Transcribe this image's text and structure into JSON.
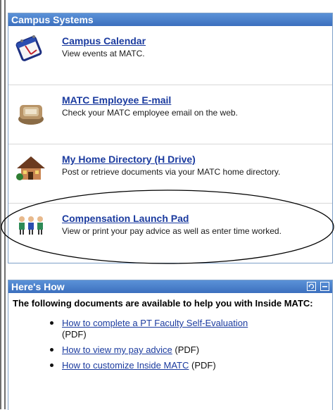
{
  "campus_systems": {
    "title": "Campus Systems",
    "items": [
      {
        "icon": "calendar-icon",
        "label": "Campus Calendar",
        "description": "View events at MATC."
      },
      {
        "icon": "email-icon",
        "label": "MATC Employee E-mail",
        "description": "Check your MATC employee email on the web."
      },
      {
        "icon": "home-directory-icon",
        "label": "My Home Directory (H Drive)",
        "description": "Post or retrieve documents via your MATC home directory."
      },
      {
        "icon": "people-icon",
        "label": "Compensation Launch Pad",
        "description": "View or print your pay advice as well as enter time worked."
      }
    ]
  },
  "heres_how": {
    "title": "Here's How",
    "intro": "The following documents are available to help you with Inside MATC:",
    "docs": [
      {
        "label": "How to complete a PT Faculty Self-Evaluation",
        "suffix": "(PDF)"
      },
      {
        "label": "How to view my pay advice",
        "suffix": "(PDF)"
      },
      {
        "label": "How to customize Inside MATC",
        "suffix": "(PDF)"
      }
    ]
  },
  "colors": {
    "header": "#4a80cc",
    "link": "#1b3b9f",
    "border": "#7ea0c8"
  }
}
